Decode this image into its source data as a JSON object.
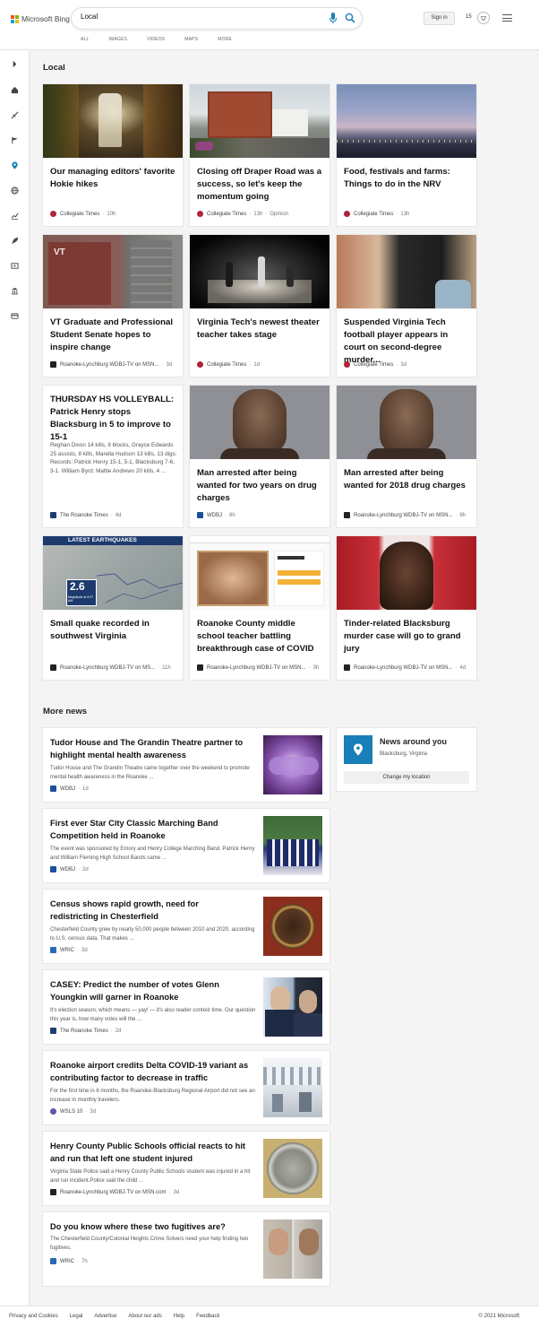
{
  "header": {
    "logo_text": "Microsoft Bing",
    "search_value": "Local",
    "nav": [
      "ALL",
      "IMAGES",
      "VIDEOS",
      "MAPS",
      "MORE"
    ],
    "signin": "Sign in",
    "points": "15"
  },
  "sidebar": {
    "icons": [
      "chevron-right-icon",
      "home-icon",
      "sports-icon",
      "flag-icon",
      "location-icon",
      "globe-icon",
      "chart-icon",
      "rocket-icon",
      "video-icon",
      "bank-icon",
      "card-icon"
    ]
  },
  "local": {
    "title": "Local",
    "cards": [
      {
        "title": "Our managing editors' favorite Hokie hikes",
        "source": "Collegiate Times",
        "meta": [
          "10h"
        ]
      },
      {
        "title": "Closing off Draper Road was a success, so let's keep the momentum going",
        "source": "Collegiate Times",
        "meta": [
          "13h",
          "Opinion"
        ]
      },
      {
        "title": "Food, festivals and farms: Things to do in the NRV",
        "source": "Collegiate Times",
        "meta": [
          "13h"
        ]
      },
      {
        "title": "VT Graduate and Professional Student Senate hopes to inspire change",
        "source": "Roanoke-Lynchburg WDBJ-TV on MSN...",
        "meta": [
          "3d"
        ]
      },
      {
        "title": "Virginia Tech's newest theater teacher takes stage",
        "source": "Collegiate Times",
        "meta": [
          "1d"
        ]
      },
      {
        "title": "Suspended Virginia Tech football player appears in court on second-degree murder...",
        "source": "Collegiate Times",
        "meta": [
          "3d"
        ]
      },
      {
        "title": "THURSDAY HS VOLLEYBALL: Patrick Henry stops Blacksburg in 5 to improve to 15-1",
        "snippet": "Reghan Dixon 14 kills, 8 blocks, Grayce Edwards 25 assists, 8 kills, Marella Hudson 13 kills, 13 digs: Records: Patrick Henry 15-1, 5-1, Blacksburg 7-6, 3-1. William Byrd: Mattie Andrews 20 kills, 4 ...",
        "source": "The Roanoke Times",
        "meta": [
          "4d"
        ]
      },
      {
        "title": "Man arrested after being wanted for two years on drug charges",
        "source": "WDBJ",
        "meta": [
          "8h"
        ]
      },
      {
        "title": "Man arrested after being wanted for 2018 drug charges",
        "source": "Roanoke-Lynchburg WDBJ-TV on MSN...",
        "meta": [
          "8h"
        ]
      },
      {
        "title": "Small quake recorded in southwest Virginia",
        "source": "Roanoke-Lynchburg WDBJ-TV on MS...",
        "meta": [
          "11h"
        ]
      },
      {
        "title": "Roanoke County middle school teacher battling breakthrough case of COVID",
        "source": "Roanoke-Lynchburg WDBJ-TV on MSN...",
        "meta": [
          "3h"
        ]
      },
      {
        "title": "Tinder-related Blacksburg murder case will go to grand jury",
        "source": "Roanoke-Lynchburg WDBJ-TV on MSN...",
        "meta": [
          "4d"
        ]
      }
    ],
    "quake_banner": "LATEST EARTHQUAKES",
    "quake_magnitude": "2.6",
    "quake_sub": "Magnitude at 9:37 AM"
  },
  "more_news": {
    "title": "More news",
    "items": [
      {
        "title": "Tudor House and The Grandin Theatre partner to highlight mental health awareness",
        "snippet": "Tudor House and The Grandin Theatre came together over the weekend to promote mental health awareness in the Roanoke ...",
        "source": "WDBJ",
        "meta": "1d"
      },
      {
        "title": "First ever Star City Classic Marching Band Competition held in Roanoke",
        "snippet": "The event was sponsored by Emory and Henry College Marching Band. Patrick Henry and William Fleming High School Bands came ...",
        "source": "WDBJ",
        "meta": "2d"
      },
      {
        "title": "Census shows rapid growth, need for redistricting in Chesterfield",
        "snippet": "Chesterfield County grew by nearly 50,000 people between 2010 and 2020, according to U.S. census data. That makes ...",
        "source": "WRIC",
        "meta": "3d"
      },
      {
        "title": "CASEY: Predict the number of votes Glenn Youngkin will garner in Roanoke",
        "snippet": "It's election season, which means — yay! — it's also reader contest time. Our question this year is, how many votes will the ...",
        "source": "The Roanoke Times",
        "meta": "2d"
      },
      {
        "title": "Roanoke airport credits Delta COVID-19 variant as contributing factor to decrease in traffic",
        "snippet": "For the first time in 6 months, the Roanoke-Blacksburg Regional Airport did not see an increase in monthly travelers.",
        "source": "WSLS 10",
        "meta": "3d"
      },
      {
        "title": "Henry County Public Schools official reacts to hit and run that left one student injured",
        "snippet": "Virginia State Police said a Henry County Public Schools student was injured in a hit and run incident.Police said the child ...",
        "source": "Roanoke-Lynchburg WDBJ-TV on MSN.com",
        "meta": "3d"
      },
      {
        "title": "Do you know where these two fugitives are?",
        "snippet": "The Chesterfield County/Colonial Heights Crime Solvers need your help finding two fugitives.",
        "source": "WRIC",
        "meta": "7h"
      }
    ]
  },
  "news_around": {
    "title": "News around you",
    "location": "Blacksburg, Virginia",
    "button": "Change my location"
  },
  "footer": {
    "links": [
      "Privacy and Cookies",
      "Legal",
      "Advertise",
      "About our ads",
      "Help",
      "Feedback"
    ],
    "copyright": "© 2021 Microsoft"
  },
  "colors": {
    "accent": "#1a7fb7",
    "collegiate_times": "#b0243a",
    "wdbj": "#1d4f9c"
  }
}
